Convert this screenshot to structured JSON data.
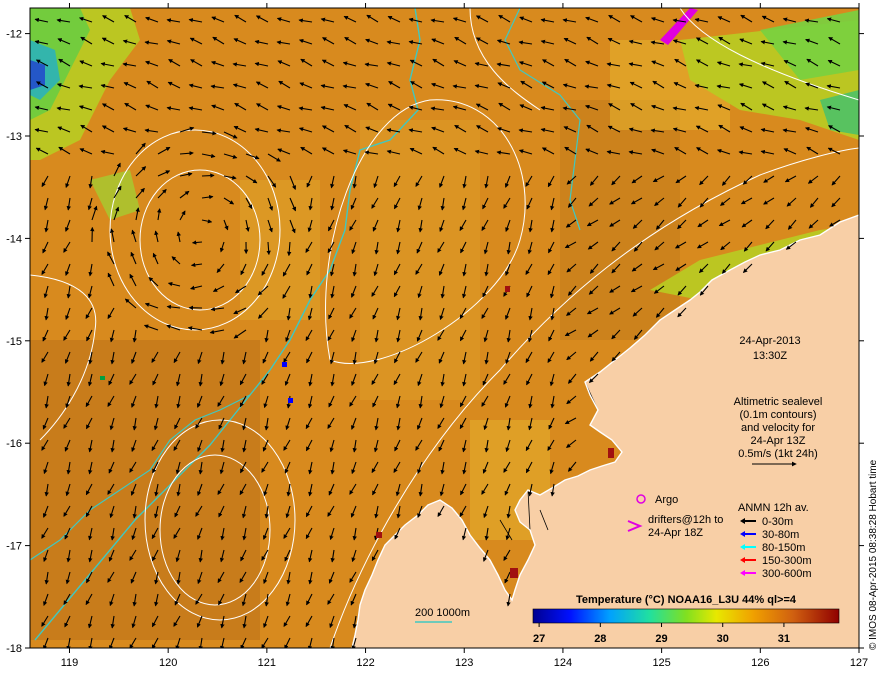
{
  "axes": {
    "x_ticks": [
      "119",
      "120",
      "121",
      "122",
      "123",
      "124",
      "125",
      "126",
      "127"
    ],
    "y_ticks": [
      "-12",
      "-13",
      "-14",
      "-15",
      "-16",
      "-17",
      "-18"
    ],
    "lon_range": [
      118.6,
      127.0
    ],
    "lat_range": [
      -18.0,
      -11.75
    ]
  },
  "timestamp": {
    "date": "24-Apr-2013",
    "time": "13:30Z"
  },
  "altimetry_note": {
    "line1": "Altimetric sealevel",
    "line2": "(0.1m contours)",
    "line3": "and velocity for",
    "line4": "24-Apr 13Z",
    "line5": "0.5m/s (1kt 24h)"
  },
  "legend": {
    "argo": "Argo",
    "drifters_line1": "drifters@12h to",
    "drifters_line2": "24-Apr 18Z",
    "anmn_title": "ANMN 12h av.",
    "depths": [
      {
        "label": "0-30m",
        "color": "#000000"
      },
      {
        "label": "30-80m",
        "color": "#0000ff"
      },
      {
        "label": "80-150m",
        "color": "#00ffff"
      },
      {
        "label": "150-300m",
        "color": "#ff0000"
      },
      {
        "label": "300-600m",
        "color": "#ff00ff"
      }
    ],
    "isobath_label": "200  1000m"
  },
  "colorbar": {
    "title": "Temperature (°C) NOAA16_L3U 44% ql>=4",
    "ticks": [
      "27",
      "28",
      "29",
      "30",
      "31"
    ],
    "range": [
      26.9,
      31.9
    ]
  },
  "credit": "© IMOS 08-Apr-2015 08:38:28 Hobart time",
  "colors": {
    "land": "#f8cfa6",
    "ocean_warm": "#d98a1d",
    "ocean_cool": "#c2cc22",
    "isobath": "#40c8c0",
    "contour": "#ffffff",
    "arrow": "#000000",
    "argo": "#e000e0",
    "drifter": "#e000e0"
  }
}
